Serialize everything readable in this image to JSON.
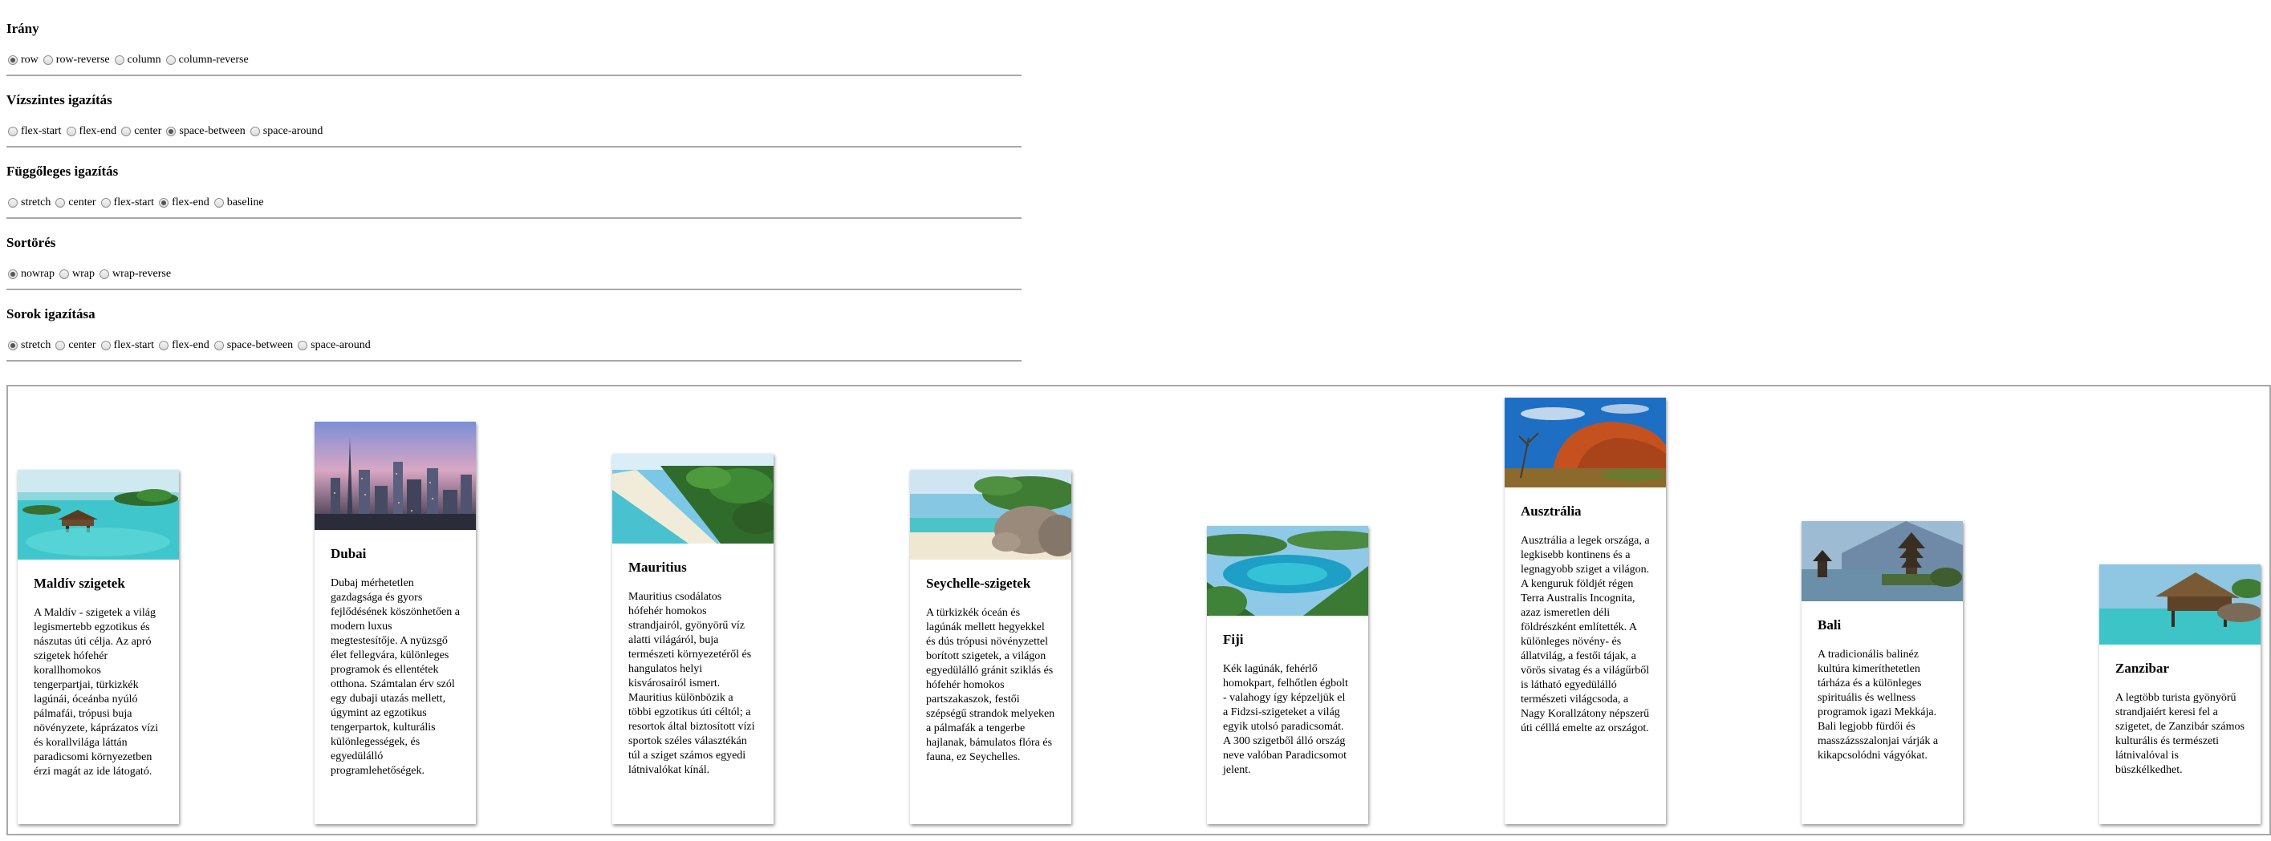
{
  "groups": [
    {
      "title": "Irány",
      "options": [
        {
          "label": "row",
          "checked": true
        },
        {
          "label": "row-reverse",
          "checked": false
        },
        {
          "label": "column",
          "checked": false
        },
        {
          "label": "column-reverse",
          "checked": false
        }
      ]
    },
    {
      "title": "Vízszintes igazítás",
      "options": [
        {
          "label": "flex-start",
          "checked": false
        },
        {
          "label": "flex-end",
          "checked": false
        },
        {
          "label": "center",
          "checked": false
        },
        {
          "label": "space-between",
          "checked": true
        },
        {
          "label": "space-around",
          "checked": false
        }
      ]
    },
    {
      "title": "Függőleges igazítás",
      "options": [
        {
          "label": "stretch",
          "checked": false
        },
        {
          "label": "center",
          "checked": false
        },
        {
          "label": "flex-start",
          "checked": false
        },
        {
          "label": "flex-end",
          "checked": true
        },
        {
          "label": "baseline",
          "checked": false
        }
      ]
    },
    {
      "title": "Sortörés",
      "options": [
        {
          "label": "nowrap",
          "checked": true
        },
        {
          "label": "wrap",
          "checked": false
        },
        {
          "label": "wrap-reverse",
          "checked": false
        }
      ]
    },
    {
      "title": "Sorok igazítása",
      "options": [
        {
          "label": "stretch",
          "checked": true
        },
        {
          "label": "center",
          "checked": false
        },
        {
          "label": "flex-start",
          "checked": false
        },
        {
          "label": "flex-end",
          "checked": false
        },
        {
          "label": "space-between",
          "checked": false
        },
        {
          "label": "space-around",
          "checked": false
        }
      ]
    }
  ],
  "cards": [
    {
      "title": "Maldív szigetek",
      "image": "maldives-resort-photo",
      "text": "A Maldív - szigetek a világ legismertebb egzotikus és nászutas úti célja. Az apró szigetek hófehér korallhomokos tengerpartjai, türkizkék lagúnái, óceánba nyúló pálmafái, trópusi buja növényzete, káprázatos vízi és korallvilága láttán paradicsomi környezetben érzi magát az ide látogató."
    },
    {
      "title": "Dubai",
      "image": "dubai-skyline-photo",
      "text": "Dubaj mérhetetlen gazdagsága és gyors fejlődésének köszönhetően a modern luxus megtestesítője. A nyüzsgő élet fellegvára, különleges programok és ellentétek otthona. Számtalan érv szól egy dubaji utazás mellett, úgymint az egzotikus tengerpartok, kulturális különlegességek, és egyedülálló programlehetőségek."
    },
    {
      "title": "Mauritius",
      "image": "mauritius-beach-photo",
      "text": "Mauritius csodálatos hófehér homokos strandjairól, gyönyörű víz alatti világáról, buja természeti környezetéről és hangulatos helyi kisvárosairól ismert. Mauritius különbözik a többi egzotikus úti céltól; a resortok által biztosított vízi sportok széles választékán túl a sziget számos egyedi látnivalókat kínál."
    },
    {
      "title": "Seychelle-szigetek",
      "image": "seychelles-rocks-photo",
      "text": "A türkizkék óceán és lagúnák mellett hegyekkel és dús trópusi növényzettel borított szigetek, a világon egyedülálló gránit sziklás és hófehér homokos partszakaszok, festői szépségű strandok melyeken a pálmafák a tengerbe hajlanak, bámulatos flóra és fauna, ez Seychelles."
    },
    {
      "title": "Fiji",
      "image": "fiji-lagoon-photo",
      "text": "Kék lagúnák, fehérlő homokpart, felhőtlen égbolt - valahogy így képzeljük el a Fidzsi-szigeteket a világ egyik utolsó paradicsomát. A 300 szigetből álló ország neve valóban Paradicsomot jelent."
    },
    {
      "title": "Ausztrália",
      "image": "australia-uluru-photo",
      "text": "Ausztrália a legek országa, a legkisebb kontinens és a legnagyobb sziget a világon. A kenguruk földjét régen Terra Australis Incognita, azaz ismeretlen déli földrészként említették. A különleges növény- és állatvilág, a festői tájak, a vörös sivatag és a világűrből is látható egyedülálló természeti világcsoda, a Nagy Korallzátony népszerű úti célllá emelte az országot."
    },
    {
      "title": "Bali",
      "image": "bali-temple-photo",
      "text": "A tradicionális balinéz kultúra kimeríthetetlen tárháza és a különleges spirituális és wellness programok igazi Mekkája. Bali legjobb fürdői és masszázsszalonjai várják a kikapcsolódni vágyókat."
    },
    {
      "title": "Zanzibar",
      "image": "zanzibar-hut-photo",
      "text": "A legtöbb turista gyönyörű strandjaiért keresi fel a szigetet, de Zanzibár számos kulturális és természeti látnivalóval is büszkélkedhet."
    }
  ]
}
